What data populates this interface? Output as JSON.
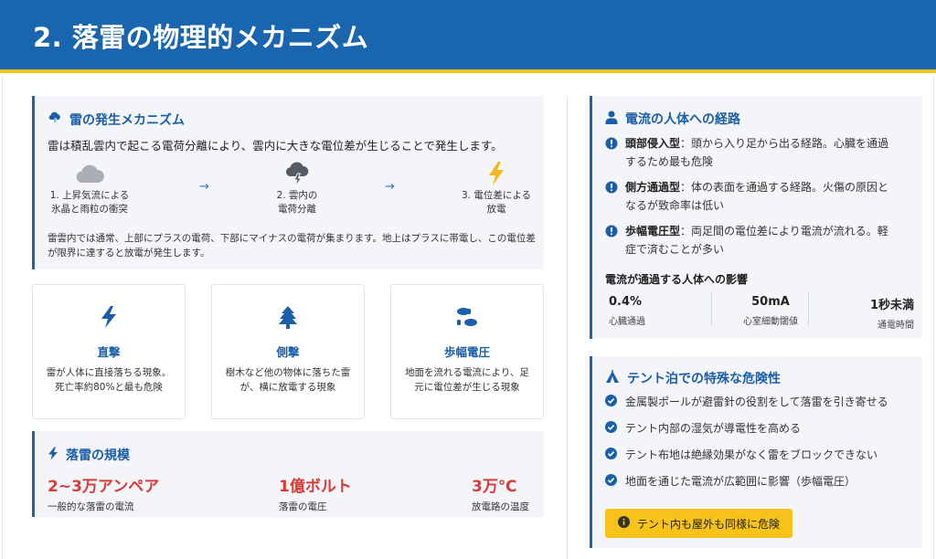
{
  "header": {
    "title": "2. 落雷の物理的メカニズム"
  },
  "mechanism": {
    "title": "雷の発生メカニズム",
    "lead": "雷は積乱雲内で起こる電荷分離により、雲内に大きな電位差が生じることで発生します。",
    "steps": [
      {
        "icon": "cloud-icon",
        "line1": "1. 上昇気流による",
        "line2": "氷晶と雨粒の衝突"
      },
      {
        "icon": "thunder-cloud-icon",
        "line1": "2. 雲内の",
        "line2": "電荷分離"
      },
      {
        "icon": "lightning-icon",
        "line1": "3. 電位差による",
        "line2": "放電"
      }
    ],
    "arrow": "→",
    "note": "雷雲内では通常、上部にプラスの電荷、下部にマイナスの電荷が集まります。地上はプラスに帯電し、この電位差が限界に達すると放電が発生します。"
  },
  "strike_types": [
    {
      "icon": "bolt-icon",
      "title": "直撃",
      "desc": "雷が人体に直接落ちる現象。死亡率約80%と最も危険"
    },
    {
      "icon": "tree-icon",
      "title": "側撃",
      "desc": "樹木など他の物体に落ちた雷が、横に放電する現象"
    },
    {
      "icon": "footprints-icon",
      "title": "歩幅電圧",
      "desc": "地面を流れる電流により、足元に電位差が生じる現象"
    }
  ],
  "scale": {
    "title": "落雷の規模",
    "stats": [
      {
        "value": "2~3万アンペア",
        "label": "一般的な落雷の電流"
      },
      {
        "value": "1億ボルト",
        "label": "落雷の電圧"
      },
      {
        "value": "3万℃",
        "label": "放電路の温度"
      }
    ]
  },
  "body_path": {
    "title": "電流の人体への経路",
    "routes": [
      {
        "name": "頭部侵入型",
        "line1": "：頭から入り足から出る経路。心臓を通過",
        "line2": "するため最も危険"
      },
      {
        "name": "側方通過型",
        "line1": "：体の表面を通過する経路。火傷の原因と",
        "line2": "なるが致命率は低い"
      },
      {
        "name": "歩幅電圧型",
        "line1": "：両足間の電位差により電流が流れる。軽",
        "line2": "症で済むことが多い"
      }
    ],
    "effects_title": "電流が通過する人体への影響",
    "metrics": [
      {
        "value": "0.4%",
        "label": "心臓通過"
      },
      {
        "value": "50mA",
        "label": "心室細動閾値"
      },
      {
        "value": "1秒未満",
        "label": "通電時間"
      }
    ]
  },
  "tent": {
    "title": "テント泊での特殊な危険性",
    "items": [
      "金属製ポールが避雷針の役割をして落雷を引き寄せる",
      "テント内部の湿気が導電性を高める",
      "テント布地は絶縁効果がなく雷をブロックできない",
      "地面を通じた電流が広範囲に影響（歩幅電圧）"
    ],
    "warning": "テント内も屋外も同様に危険"
  },
  "colors": {
    "primary": "#1a66ae",
    "accent": "#f5c518",
    "danger": "#d93a3a",
    "warning": "#f7c21a",
    "icon_gray": "#a9adb4"
  }
}
